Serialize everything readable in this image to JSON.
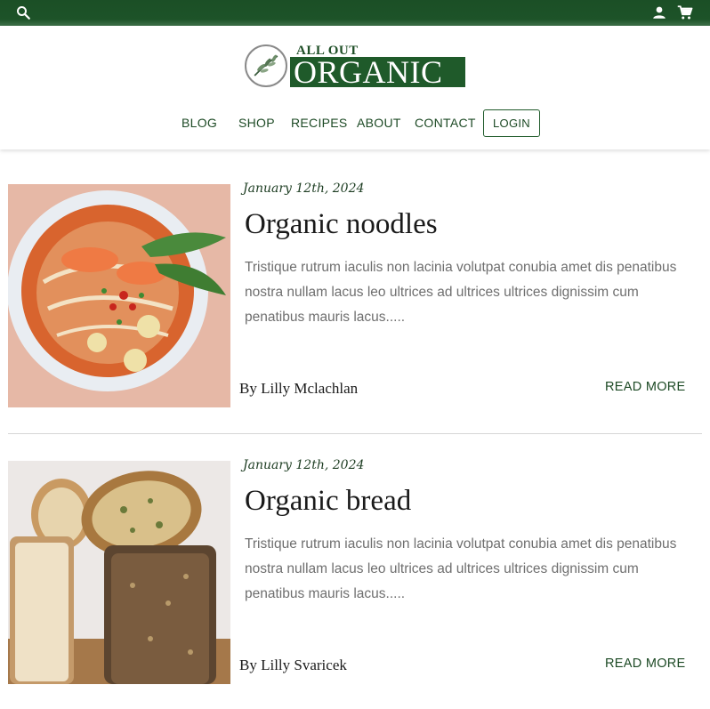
{
  "topbar": {
    "icons": [
      "search-icon",
      "user-icon",
      "cart-icon"
    ],
    "color": "#1d5328"
  },
  "brand": {
    "top_text": "ALL OUT",
    "main_text": "ORGANIC",
    "color": "#1f5a2a"
  },
  "nav": {
    "items": [
      {
        "label": "BLOG"
      },
      {
        "label": "SHOP"
      },
      {
        "label": "RECIPES"
      },
      {
        "label": "ABOUT"
      },
      {
        "label": "CONTACT"
      }
    ],
    "login_label": "LOGIN"
  },
  "posts": [
    {
      "date": "January 12th, 2024",
      "title": "Organic noodles",
      "excerpt": "Tristique rutrum iaculis non lacinia volutpat conubia amet dis penatibus nostra nullam lacus leo ultrices ad ultrices ultrices dignissim cum penatibus mauris lacus.....",
      "author": "By Lilly Mclachlan",
      "read_more": "READ MORE"
    },
    {
      "date": "January 12th, 2024",
      "title": "Organic bread",
      "excerpt": "Tristique rutrum iaculis non lacinia volutpat conubia amet dis penatibus nostra nullam lacus leo ultrices ad ultrices ultrices dignissim cum penatibus mauris lacus.....",
      "author": "By Lilly Svaricek",
      "read_more": "READ MORE"
    }
  ]
}
